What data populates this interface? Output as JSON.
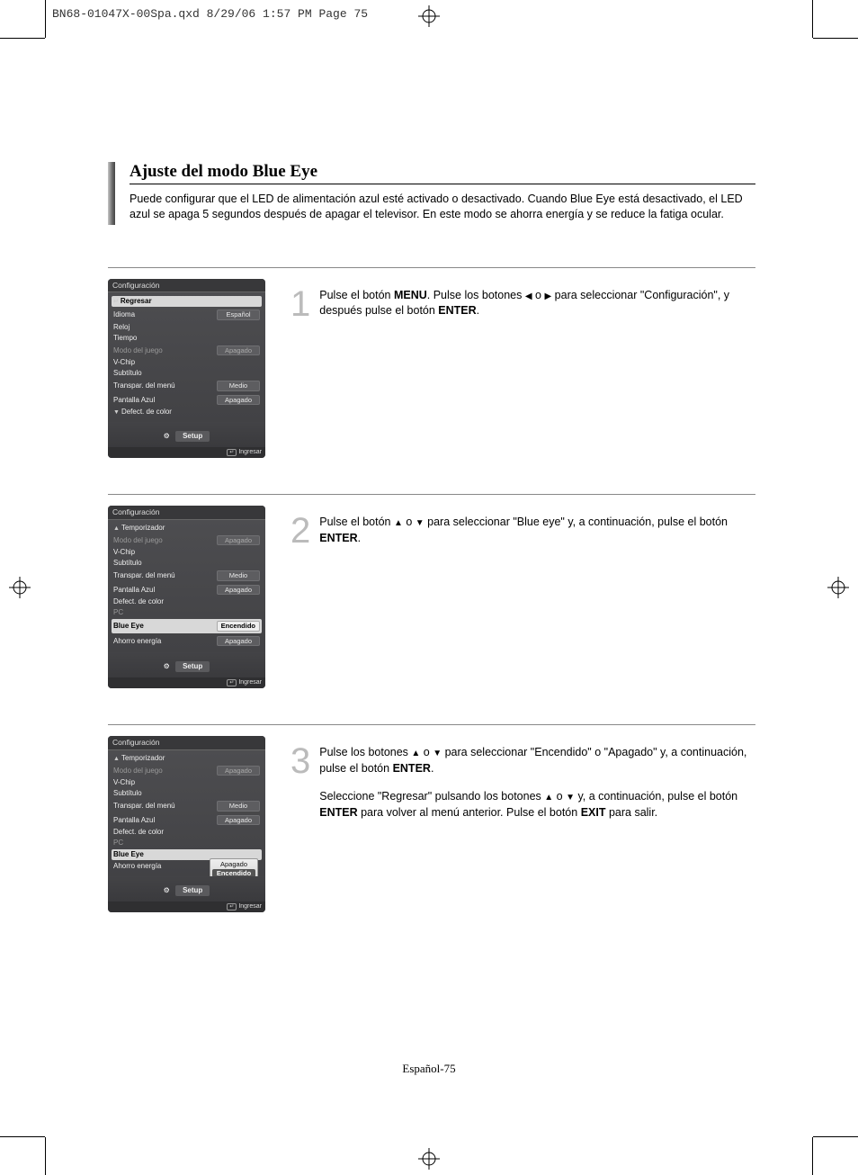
{
  "print_header": "BN68-01047X-00Spa.qxd  8/29/06  1:57 PM  Page 75",
  "title": "Ajuste del modo Blue Eye",
  "intro": "Puede configurar que el LED de alimentación azul esté activado o desactivado. Cuando Blue Eye está desactivado, el LED azul se apaga 5 segundos después de apagar el televisor. En este modo se ahorra energía y se reduce la fatiga ocular.",
  "footer_page": "Español-75",
  "osd": {
    "title": "Configuración",
    "setup": "Setup",
    "ingresar": "Ingresar",
    "labels": {
      "regresar": "Regresar",
      "idioma": "Idioma",
      "reloj": "Reloj",
      "tiempo": "Tiempo",
      "modo_juego": "Modo del juego",
      "vchip": "V-Chip",
      "subtitulo": "Subtítulo",
      "transpar": "Transpar. del menú",
      "pantalla_azul": "Pantalla Azul",
      "defect_color": "Defect. de color",
      "temporizador": "Temporizador",
      "pc": "PC",
      "blue_eye": "Blue Eye",
      "ahorro": "Ahorro energía"
    },
    "vals": {
      "espanol": "Español",
      "apagado": "Apagado",
      "medio": "Medio",
      "encendido": "Encendido"
    }
  },
  "steps": {
    "s1": {
      "num": "1",
      "text_a": "Pulse el botón ",
      "bold_a": "MENU",
      "text_b": ". Pulse los botones ",
      "text_c": " o ",
      "text_d": " para seleccionar \"Configuración\", y después pulse el botón ",
      "bold_b": "ENTER",
      "text_e": "."
    },
    "s2": {
      "num": "2",
      "text_a": "Pulse el botón ",
      "text_b": " o ",
      "text_c": " para seleccionar \"Blue eye\" y, a continuación, pulse el botón ",
      "bold_a": "ENTER",
      "text_d": "."
    },
    "s3": {
      "num": "3",
      "p1_a": "Pulse los botones ",
      "p1_b": " o ",
      "p1_c": " para seleccionar \"Encendido\" o \"Apagado\" y, a continuación, pulse el botón ",
      "p1_bold": "ENTER",
      "p1_d": ".",
      "p2_a": "Seleccione \"Regresar\" pulsando los botones ",
      "p2_b": " o ",
      "p2_c": " y, a continuación, pulse el botón  ",
      "p2_bold1": "ENTER",
      "p2_d": " para volver al menú anterior. Pulse el botón ",
      "p2_bold2": "EXIT",
      "p2_e": " para salir."
    }
  }
}
